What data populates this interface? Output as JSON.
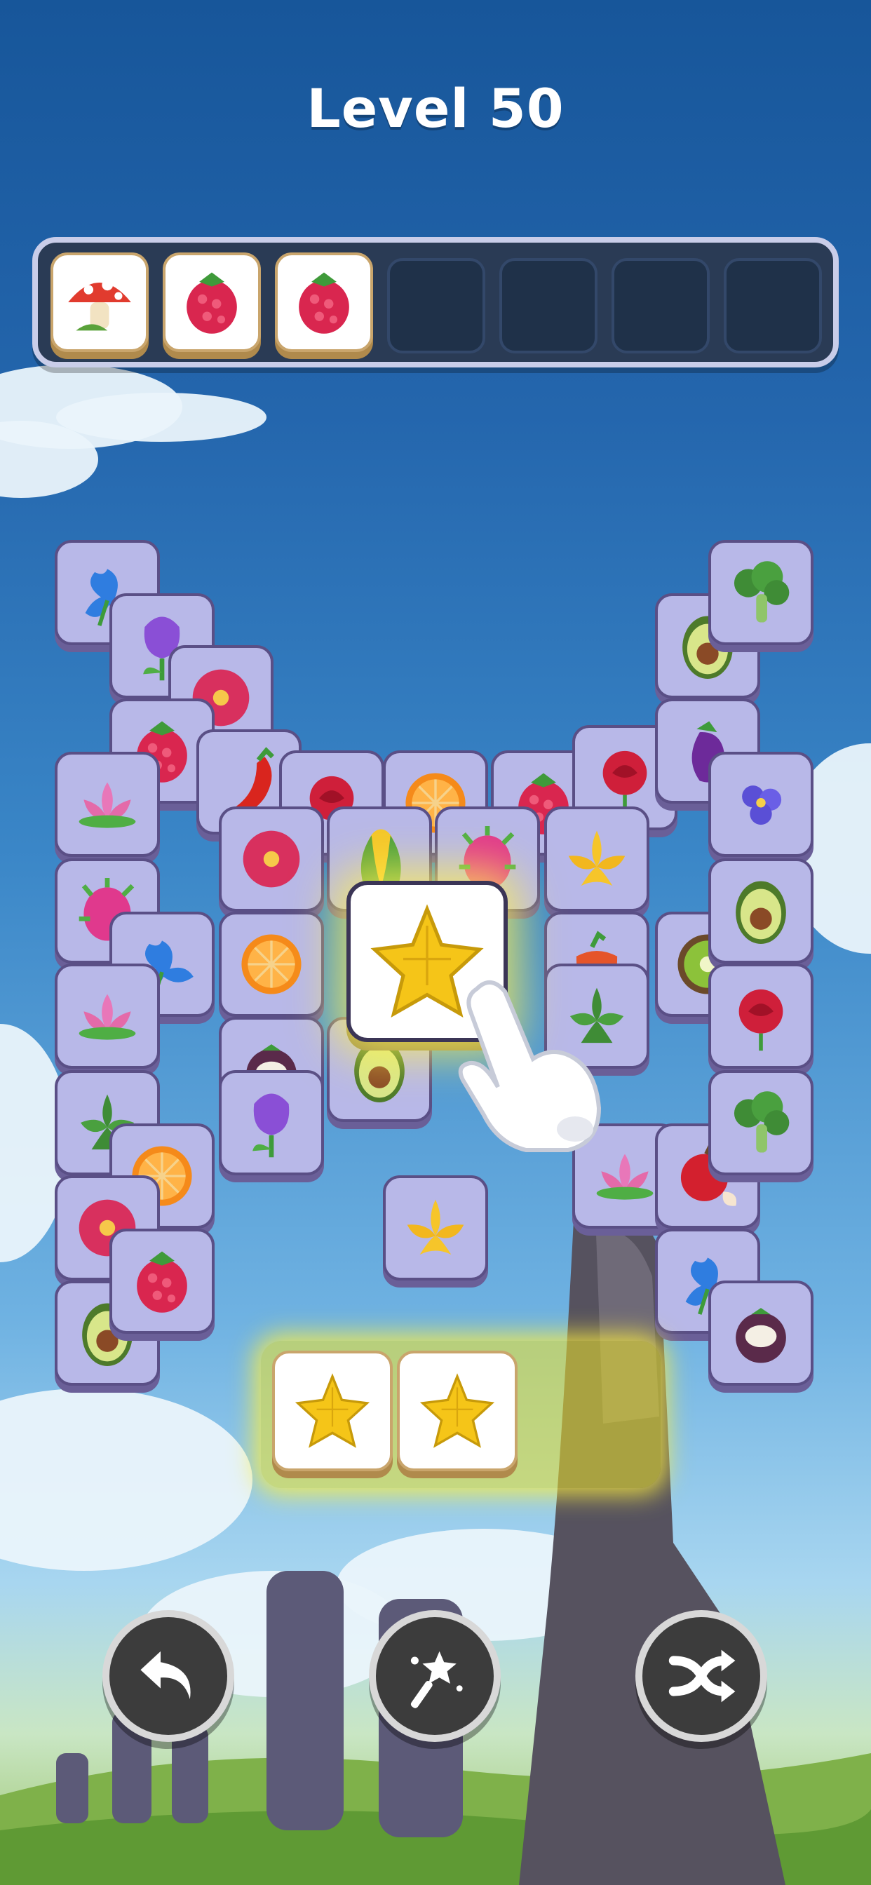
{
  "level_title": "Level 50",
  "tray": {
    "capacity": 7,
    "items": [
      "mushroom-icon",
      "raspberry-icon",
      "raspberry-icon"
    ]
  },
  "board": {
    "selected_tile": "starfruit-icon",
    "tiles": [
      "iris-icon",
      "tulip-icon",
      "hibiscus-icon",
      "raspberry-icon",
      "chili-pepper-icon",
      "rose-icon",
      "lotus-icon",
      "orange-slice-icon",
      "raspberry-icon",
      "rose-icon",
      "avocado-icon",
      "eggplant-icon",
      "broccoli-icon",
      "violet-flower-icon",
      "hibiscus-icon",
      "corn-icon",
      "dragonfruit-icon",
      "lily-icon",
      "dragonfruit-icon",
      "iris-icon",
      "orange-slice-icon",
      "bell-pepper-icon",
      "kiwi-icon",
      "avocado-icon",
      "lotus-icon",
      "mangosteen-icon",
      "avocado-icon",
      "succulent-icon",
      "rose-icon",
      "succulent-icon",
      "orange-slice-icon",
      "tulip-icon",
      "lotus-icon",
      "apple-icon",
      "broccoli-icon",
      "hibiscus-icon",
      "lily-icon",
      "raspberry-icon",
      "iris-icon",
      "mangosteen-icon",
      "avocado-icon",
      "raspberry-icon"
    ]
  },
  "match_bar": {
    "items": [
      "starfruit-icon",
      "starfruit-icon"
    ]
  },
  "buttons": {
    "undo": "undo-icon",
    "magic_wand": "magic-wand-icon",
    "shuffle": "shuffle-icon"
  },
  "colors": {
    "tile_face": "#b8b8e8",
    "tile_white": "#ffffff",
    "tray_bg": "#2a3b55",
    "glow": "#eee428"
  }
}
